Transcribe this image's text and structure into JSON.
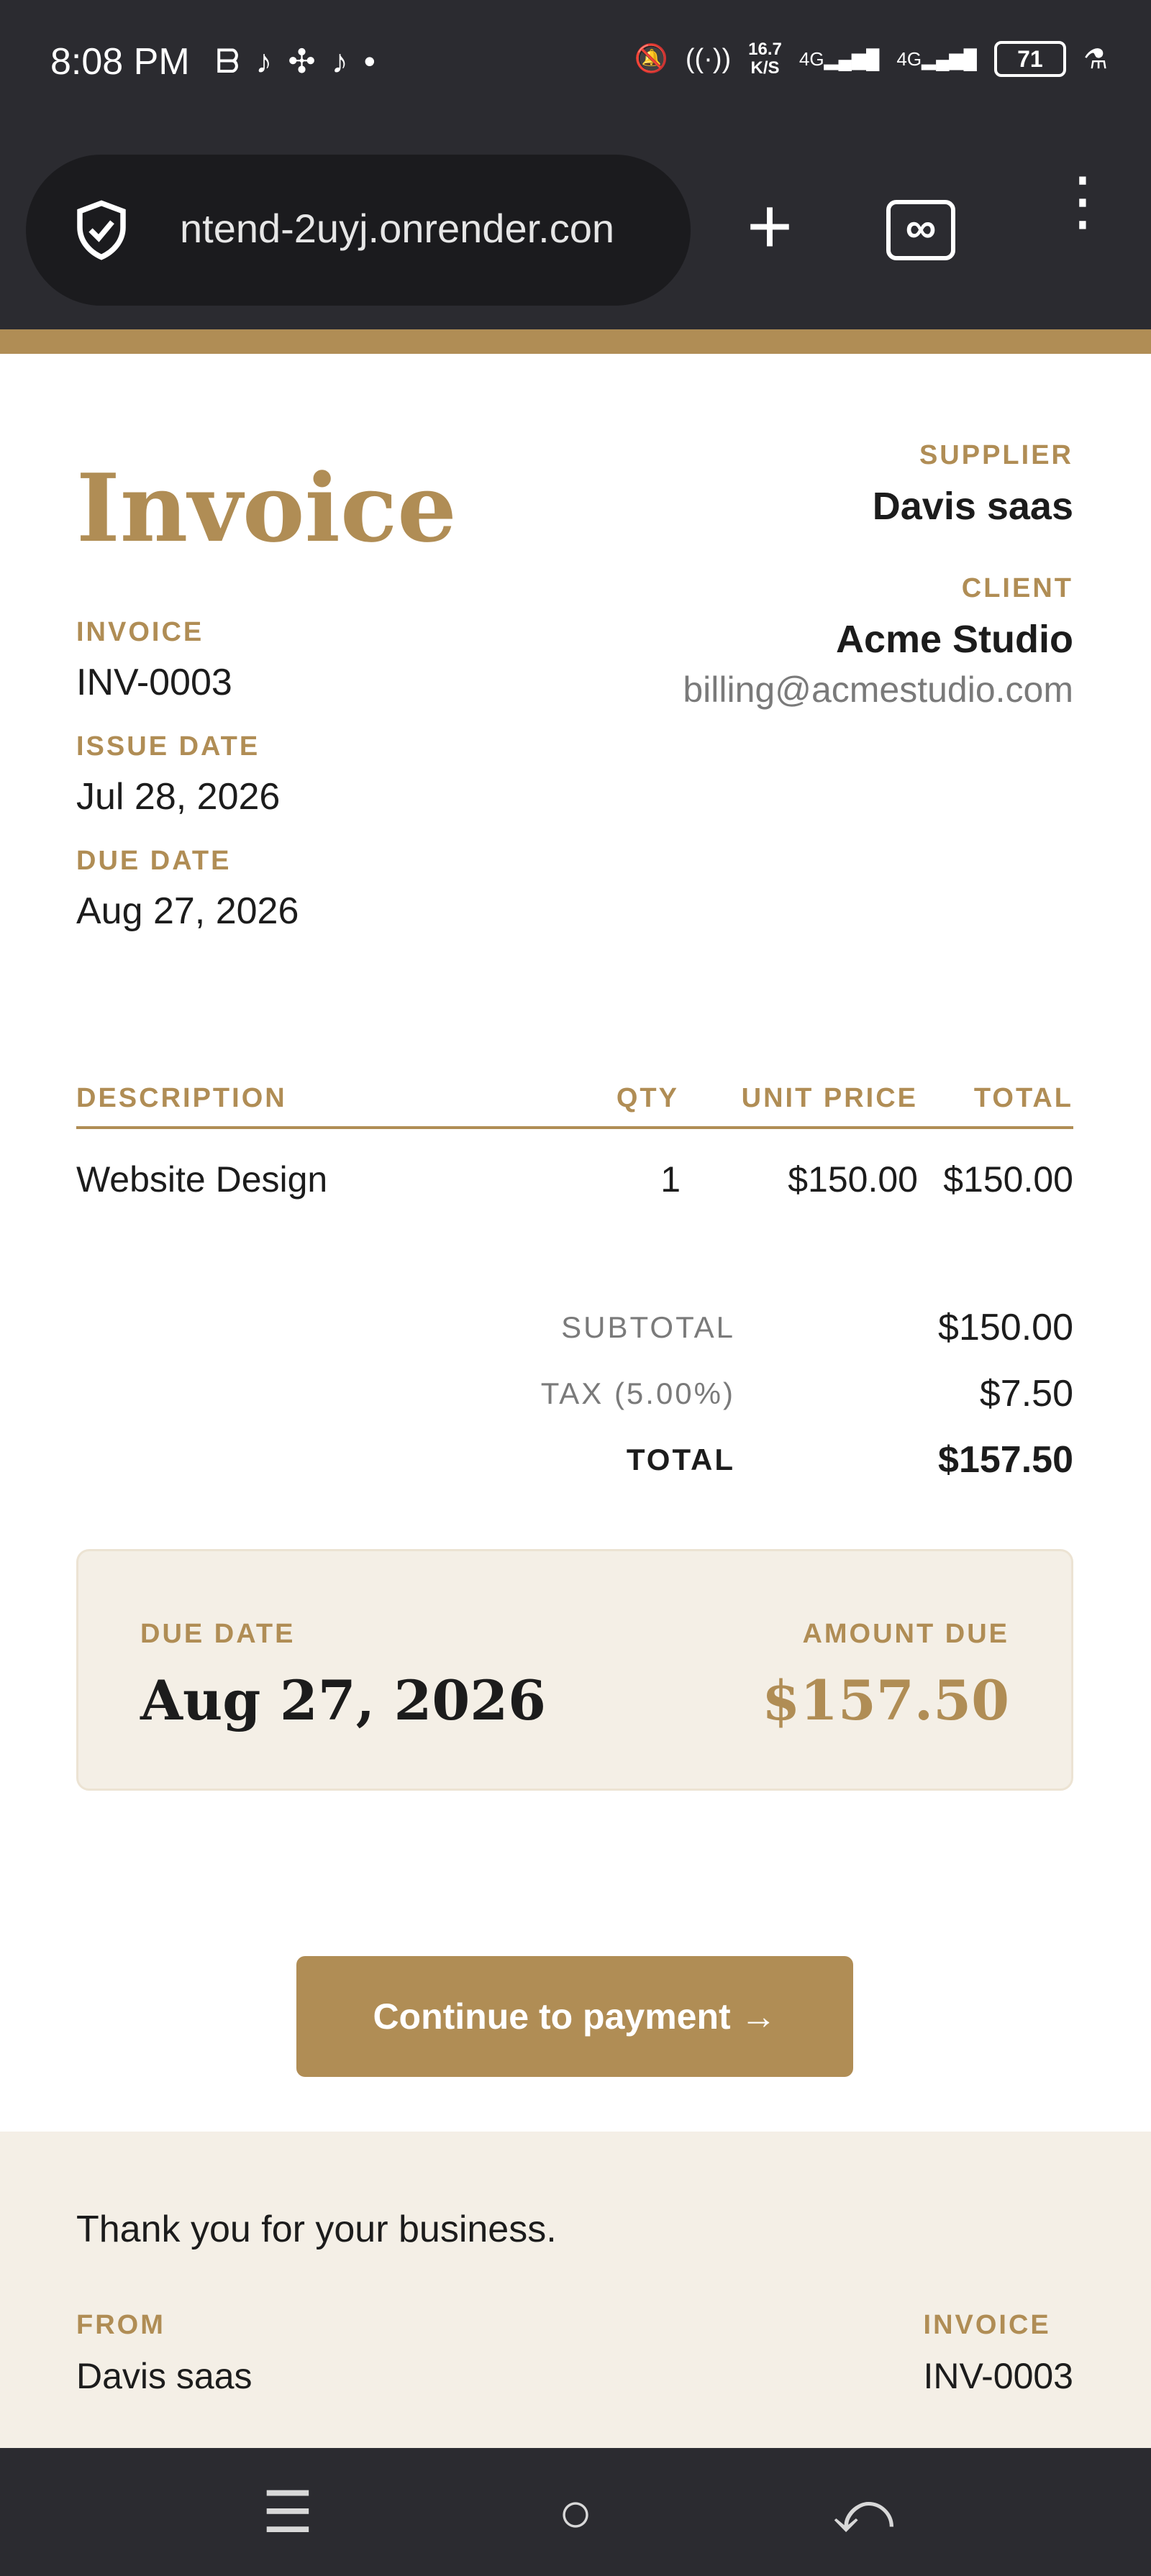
{
  "status_bar": {
    "time": "8:08 PM",
    "speed_value": "16.7",
    "speed_unit": "K/S",
    "network_1": "4G",
    "network_2": "4G",
    "battery": "71",
    "app_icons": [
      "b-icon",
      "tiktok-icon",
      "sync-icon",
      "tiktok-icon",
      "dot-icon"
    ]
  },
  "browser": {
    "url": "ntend-2uyj.onrender.con",
    "new_tab_label": "+",
    "private_label": "∞",
    "menu_label": "⋮"
  },
  "invoice": {
    "title": "Invoice",
    "invoice_label": "INVOICE",
    "invoice_number": "INV-0003",
    "issue_date_label": "ISSUE DATE",
    "issue_date": "Jul 28, 2026",
    "due_date_label": "DUE DATE",
    "due_date": "Aug 27, 2026",
    "supplier_label": "SUPPLIER",
    "supplier_name": "Davis saas",
    "client_label": "CLIENT",
    "client_name": "Acme Studio",
    "client_email": "billing@acmestudio.com"
  },
  "table": {
    "headers": {
      "description": "DESCRIPTION",
      "qty": "QTY",
      "unit_price": "UNIT PRICE",
      "total": "TOTAL"
    },
    "rows": [
      {
        "description": "Website Design",
        "qty": "1",
        "unit_price": "$150.00",
        "total": "$150.00"
      }
    ]
  },
  "totals": {
    "subtotal_label": "SUBTOTAL",
    "subtotal": "$150.00",
    "tax_label": "TAX (5.00%)",
    "tax": "$7.50",
    "total_label": "TOTAL",
    "total": "$157.50"
  },
  "due_box": {
    "due_date_label": "DUE DATE",
    "due_date": "Aug 27, 2026",
    "amount_due_label": "AMOUNT DUE",
    "amount_due": "$157.50"
  },
  "payment_button": "Continue to payment →",
  "footer": {
    "thanks": "Thank you for your business.",
    "from_label": "FROM",
    "from_value": "Davis saas",
    "invoice_label": "INVOICE",
    "invoice_value": "INV-0003"
  },
  "nav": {
    "recents": "☰",
    "home": "○",
    "back": "⤺"
  },
  "colors": {
    "accent": "#b08d55",
    "chrome": "#2b2b30",
    "panel": "#f4efe6"
  }
}
